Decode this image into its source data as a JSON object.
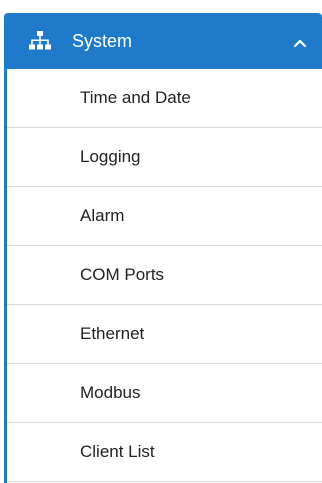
{
  "menu": {
    "header": {
      "title": "System",
      "icon": "sitemap-icon",
      "chevron": "chevron-up-icon"
    },
    "items": [
      {
        "label": "Time and Date"
      },
      {
        "label": "Logging"
      },
      {
        "label": "Alarm"
      },
      {
        "label": "COM Ports"
      },
      {
        "label": "Ethernet"
      },
      {
        "label": "Modbus"
      },
      {
        "label": "Client List"
      }
    ]
  },
  "colors": {
    "accent": "#1f7bc9",
    "text": "#222222",
    "divider": "#d9d9d9"
  }
}
